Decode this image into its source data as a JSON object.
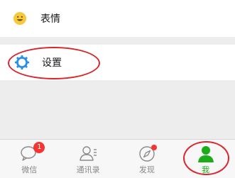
{
  "menu": {
    "emoji_label": "表情",
    "settings_label": "设置"
  },
  "tabbar": {
    "tabs": [
      {
        "label": "微信",
        "badge": "1"
      },
      {
        "label": "通讯录"
      },
      {
        "label": "发现"
      },
      {
        "label": "我"
      }
    ]
  },
  "colors": {
    "accent_green": "#1aad19",
    "badge_red": "#f43530",
    "annotation_red": "#d9252b",
    "emoji_yellow": "#f7c93a",
    "settings_blue": "#2b8fe6"
  }
}
